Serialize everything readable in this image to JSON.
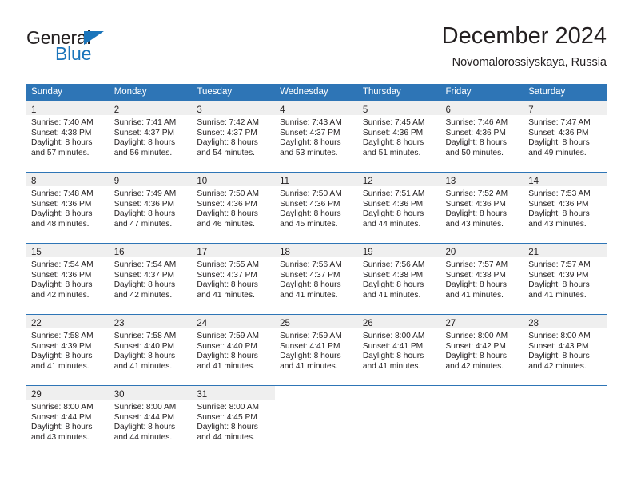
{
  "brand": {
    "name_top": "General",
    "name_bottom": "Blue",
    "triangle_color": "#1b75bb",
    "text_color": "#231f20"
  },
  "header": {
    "month_title": "December 2024",
    "location": "Novomalorossiyskaya, Russia"
  },
  "colors": {
    "header_blue": "#2e75b6",
    "date_band_gray": "#efefef",
    "text": "#231f20",
    "page_background": "#ffffff"
  },
  "calendar": {
    "weekday_headers": [
      "Sunday",
      "Monday",
      "Tuesday",
      "Wednesday",
      "Thursday",
      "Friday",
      "Saturday"
    ],
    "weeks": [
      [
        {
          "day": "1",
          "sunrise": "Sunrise: 7:40 AM",
          "sunset": "Sunset: 4:38 PM",
          "daylight_1": "Daylight: 8 hours",
          "daylight_2": "and 57 minutes."
        },
        {
          "day": "2",
          "sunrise": "Sunrise: 7:41 AM",
          "sunset": "Sunset: 4:37 PM",
          "daylight_1": "Daylight: 8 hours",
          "daylight_2": "and 56 minutes."
        },
        {
          "day": "3",
          "sunrise": "Sunrise: 7:42 AM",
          "sunset": "Sunset: 4:37 PM",
          "daylight_1": "Daylight: 8 hours",
          "daylight_2": "and 54 minutes."
        },
        {
          "day": "4",
          "sunrise": "Sunrise: 7:43 AM",
          "sunset": "Sunset: 4:37 PM",
          "daylight_1": "Daylight: 8 hours",
          "daylight_2": "and 53 minutes."
        },
        {
          "day": "5",
          "sunrise": "Sunrise: 7:45 AM",
          "sunset": "Sunset: 4:36 PM",
          "daylight_1": "Daylight: 8 hours",
          "daylight_2": "and 51 minutes."
        },
        {
          "day": "6",
          "sunrise": "Sunrise: 7:46 AM",
          "sunset": "Sunset: 4:36 PM",
          "daylight_1": "Daylight: 8 hours",
          "daylight_2": "and 50 minutes."
        },
        {
          "day": "7",
          "sunrise": "Sunrise: 7:47 AM",
          "sunset": "Sunset: 4:36 PM",
          "daylight_1": "Daylight: 8 hours",
          "daylight_2": "and 49 minutes."
        }
      ],
      [
        {
          "day": "8",
          "sunrise": "Sunrise: 7:48 AM",
          "sunset": "Sunset: 4:36 PM",
          "daylight_1": "Daylight: 8 hours",
          "daylight_2": "and 48 minutes."
        },
        {
          "day": "9",
          "sunrise": "Sunrise: 7:49 AM",
          "sunset": "Sunset: 4:36 PM",
          "daylight_1": "Daylight: 8 hours",
          "daylight_2": "and 47 minutes."
        },
        {
          "day": "10",
          "sunrise": "Sunrise: 7:50 AM",
          "sunset": "Sunset: 4:36 PM",
          "daylight_1": "Daylight: 8 hours",
          "daylight_2": "and 46 minutes."
        },
        {
          "day": "11",
          "sunrise": "Sunrise: 7:50 AM",
          "sunset": "Sunset: 4:36 PM",
          "daylight_1": "Daylight: 8 hours",
          "daylight_2": "and 45 minutes."
        },
        {
          "day": "12",
          "sunrise": "Sunrise: 7:51 AM",
          "sunset": "Sunset: 4:36 PM",
          "daylight_1": "Daylight: 8 hours",
          "daylight_2": "and 44 minutes."
        },
        {
          "day": "13",
          "sunrise": "Sunrise: 7:52 AM",
          "sunset": "Sunset: 4:36 PM",
          "daylight_1": "Daylight: 8 hours",
          "daylight_2": "and 43 minutes."
        },
        {
          "day": "14",
          "sunrise": "Sunrise: 7:53 AM",
          "sunset": "Sunset: 4:36 PM",
          "daylight_1": "Daylight: 8 hours",
          "daylight_2": "and 43 minutes."
        }
      ],
      [
        {
          "day": "15",
          "sunrise": "Sunrise: 7:54 AM",
          "sunset": "Sunset: 4:36 PM",
          "daylight_1": "Daylight: 8 hours",
          "daylight_2": "and 42 minutes."
        },
        {
          "day": "16",
          "sunrise": "Sunrise: 7:54 AM",
          "sunset": "Sunset: 4:37 PM",
          "daylight_1": "Daylight: 8 hours",
          "daylight_2": "and 42 minutes."
        },
        {
          "day": "17",
          "sunrise": "Sunrise: 7:55 AM",
          "sunset": "Sunset: 4:37 PM",
          "daylight_1": "Daylight: 8 hours",
          "daylight_2": "and 41 minutes."
        },
        {
          "day": "18",
          "sunrise": "Sunrise: 7:56 AM",
          "sunset": "Sunset: 4:37 PM",
          "daylight_1": "Daylight: 8 hours",
          "daylight_2": "and 41 minutes."
        },
        {
          "day": "19",
          "sunrise": "Sunrise: 7:56 AM",
          "sunset": "Sunset: 4:38 PM",
          "daylight_1": "Daylight: 8 hours",
          "daylight_2": "and 41 minutes."
        },
        {
          "day": "20",
          "sunrise": "Sunrise: 7:57 AM",
          "sunset": "Sunset: 4:38 PM",
          "daylight_1": "Daylight: 8 hours",
          "daylight_2": "and 41 minutes."
        },
        {
          "day": "21",
          "sunrise": "Sunrise: 7:57 AM",
          "sunset": "Sunset: 4:39 PM",
          "daylight_1": "Daylight: 8 hours",
          "daylight_2": "and 41 minutes."
        }
      ],
      [
        {
          "day": "22",
          "sunrise": "Sunrise: 7:58 AM",
          "sunset": "Sunset: 4:39 PM",
          "daylight_1": "Daylight: 8 hours",
          "daylight_2": "and 41 minutes."
        },
        {
          "day": "23",
          "sunrise": "Sunrise: 7:58 AM",
          "sunset": "Sunset: 4:40 PM",
          "daylight_1": "Daylight: 8 hours",
          "daylight_2": "and 41 minutes."
        },
        {
          "day": "24",
          "sunrise": "Sunrise: 7:59 AM",
          "sunset": "Sunset: 4:40 PM",
          "daylight_1": "Daylight: 8 hours",
          "daylight_2": "and 41 minutes."
        },
        {
          "day": "25",
          "sunrise": "Sunrise: 7:59 AM",
          "sunset": "Sunset: 4:41 PM",
          "daylight_1": "Daylight: 8 hours",
          "daylight_2": "and 41 minutes."
        },
        {
          "day": "26",
          "sunrise": "Sunrise: 8:00 AM",
          "sunset": "Sunset: 4:41 PM",
          "daylight_1": "Daylight: 8 hours",
          "daylight_2": "and 41 minutes."
        },
        {
          "day": "27",
          "sunrise": "Sunrise: 8:00 AM",
          "sunset": "Sunset: 4:42 PM",
          "daylight_1": "Daylight: 8 hours",
          "daylight_2": "and 42 minutes."
        },
        {
          "day": "28",
          "sunrise": "Sunrise: 8:00 AM",
          "sunset": "Sunset: 4:43 PM",
          "daylight_1": "Daylight: 8 hours",
          "daylight_2": "and 42 minutes."
        }
      ],
      [
        {
          "day": "29",
          "sunrise": "Sunrise: 8:00 AM",
          "sunset": "Sunset: 4:44 PM",
          "daylight_1": "Daylight: 8 hours",
          "daylight_2": "and 43 minutes."
        },
        {
          "day": "30",
          "sunrise": "Sunrise: 8:00 AM",
          "sunset": "Sunset: 4:44 PM",
          "daylight_1": "Daylight: 8 hours",
          "daylight_2": "and 44 minutes."
        },
        {
          "day": "31",
          "sunrise": "Sunrise: 8:00 AM",
          "sunset": "Sunset: 4:45 PM",
          "daylight_1": "Daylight: 8 hours",
          "daylight_2": "and 44 minutes."
        },
        {
          "day": "",
          "sunrise": "",
          "sunset": "",
          "daylight_1": "",
          "daylight_2": ""
        },
        {
          "day": "",
          "sunrise": "",
          "sunset": "",
          "daylight_1": "",
          "daylight_2": ""
        },
        {
          "day": "",
          "sunrise": "",
          "sunset": "",
          "daylight_1": "",
          "daylight_2": ""
        },
        {
          "day": "",
          "sunrise": "",
          "sunset": "",
          "daylight_1": "",
          "daylight_2": ""
        }
      ]
    ]
  }
}
